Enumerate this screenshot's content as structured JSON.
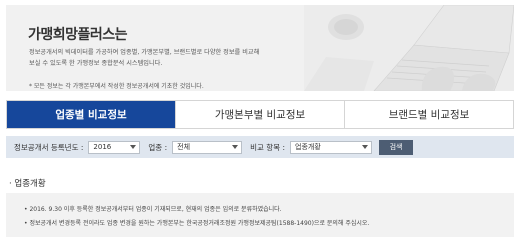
{
  "banner": {
    "title": "가맹희망플러스는",
    "desc_line1": "정보공개서의 빅데이터를 가공하여 업종별, 가맹본부별, 브랜드별로 다양한 정보를 비교해",
    "desc_line2": "보실 수 있도록 한 가맹정보 종합분석 시스템입니다.",
    "note": "* 모든 정보는 각 가맹본부에서 작성한 정보공개서에 기초한 것입니다."
  },
  "tabs": [
    {
      "label": "업종별 비교정보",
      "active": true
    },
    {
      "label": "가맹본부별 비교정보",
      "active": false
    },
    {
      "label": "브랜드별 비교정보",
      "active": false
    }
  ],
  "filter": {
    "year_label": "정보공개서 등록년도 :",
    "year_value": "2016",
    "industry_label": "업종 :",
    "industry_value": "전체",
    "compare_label": "비교 항목 :",
    "compare_value": "업종개황",
    "search_label": "검색"
  },
  "section": {
    "title": "· 업종개황",
    "notes": [
      "• 2016. 9.30 이후 등록한 정보공개서부터 업종이 기재되므로, 현재의 업종은 임의로 분류하였습니다.",
      "• 정보공개서 변경등록 전이라도 업종 변경을 원하는 가맹본부는 한국공정거래조정원 가맹정보제공팀(1588-1490)으로 문의해 주십시오."
    ]
  },
  "colors": {
    "active_tab": "#16479b",
    "filter_bg": "#dfe6ef",
    "search_button": "#4d5d73"
  }
}
